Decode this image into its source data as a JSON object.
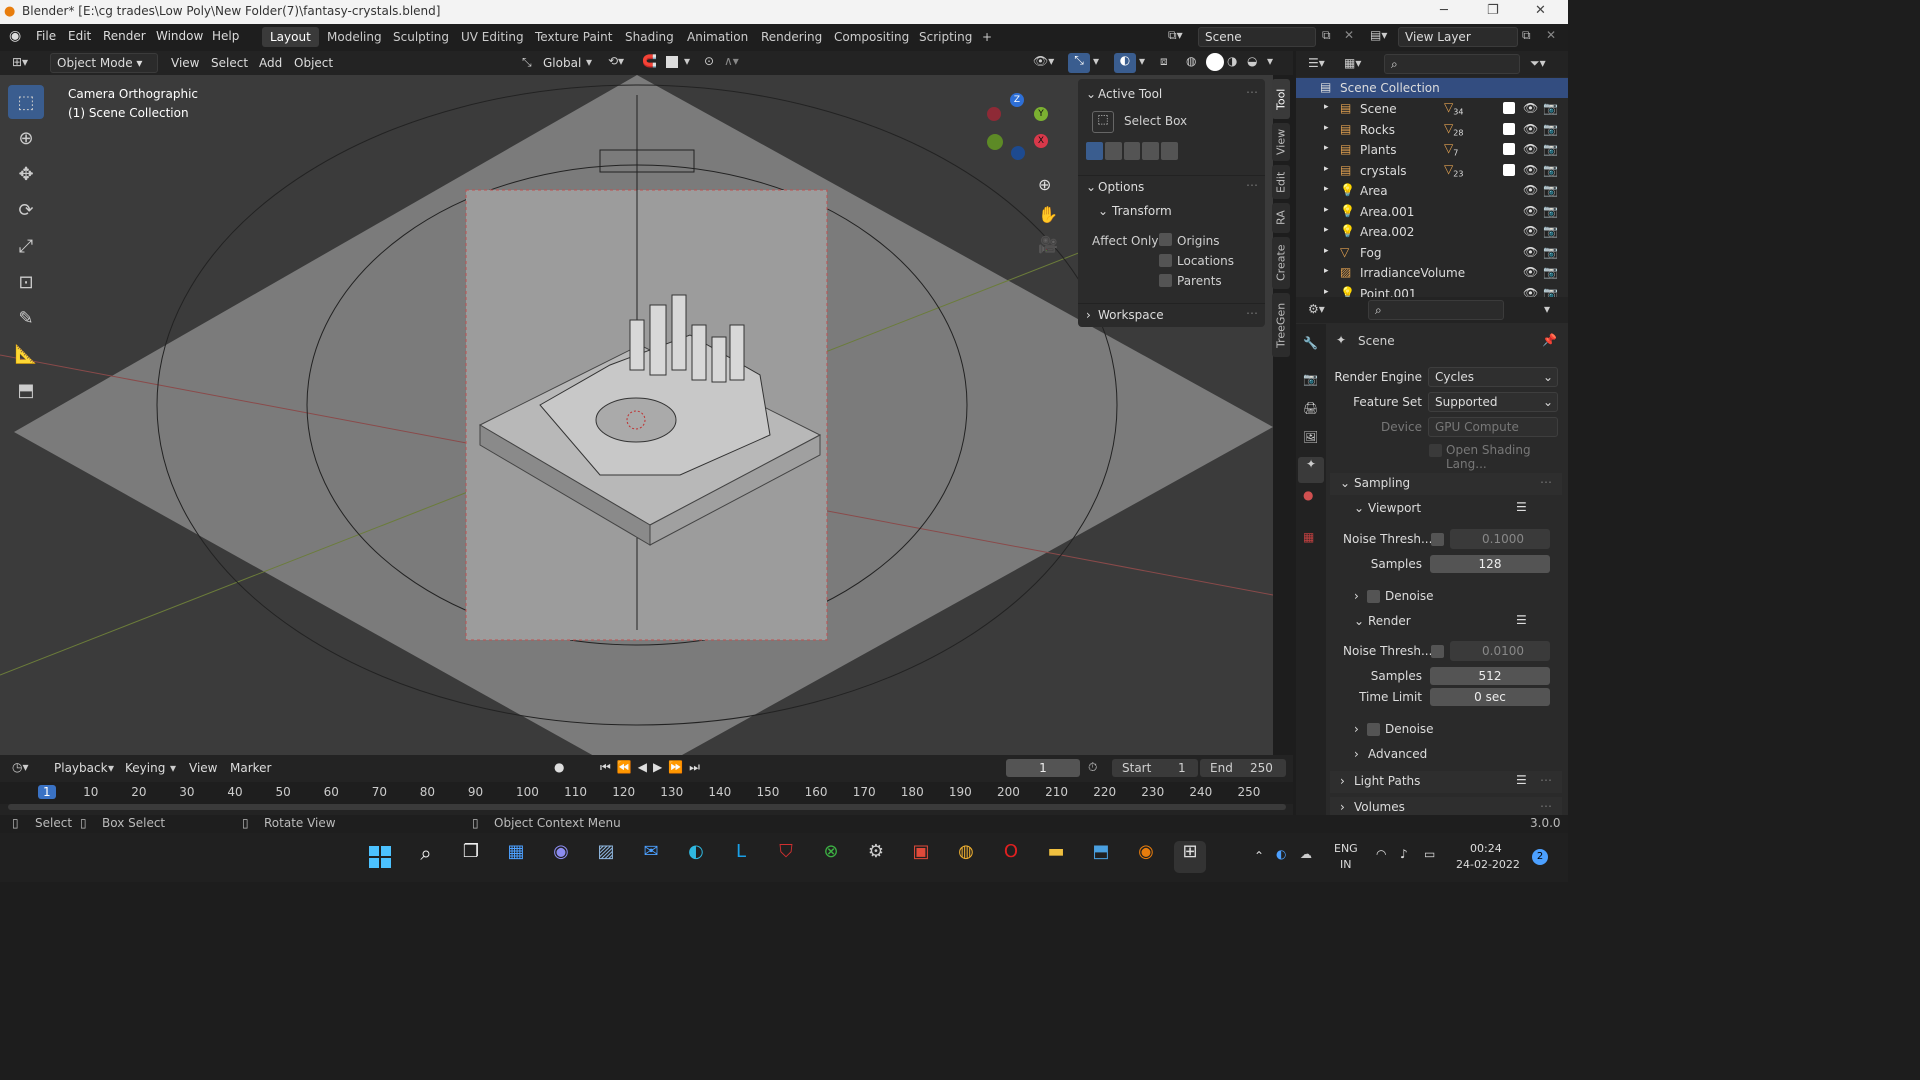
{
  "titlebar": {
    "title": "Blender* [E:\\cg trades\\Low Poly\\New Folder(7)\\fantasy-crystals.blend]",
    "minimize": "─",
    "maximize": "❐",
    "close": "✕"
  },
  "menus": [
    "File",
    "Edit",
    "Render",
    "Window",
    "Help"
  ],
  "workspaces": [
    "Layout",
    "Modeling",
    "Sculpting",
    "UV Editing",
    "Texture Paint",
    "Shading",
    "Animation",
    "Rendering",
    "Compositing",
    "Scripting"
  ],
  "workspace_add": "+",
  "scene_field": "Scene",
  "view_layer_field": "View Layer",
  "viewport_header": {
    "mode": "Object Mode",
    "menus": [
      "View",
      "Select",
      "Add",
      "Object"
    ],
    "orientation": "Global"
  },
  "viewport": {
    "camera_label": "Camera Orthographic",
    "collection_label": "(1) Scene Collection",
    "gizmo": {
      "x": "X",
      "y": "Y",
      "z": "Z"
    }
  },
  "active_tool": {
    "header": "Active Tool",
    "tool_name": "Select Box"
  },
  "options": {
    "header": "Options",
    "transform_header": "Transform",
    "affect_only": "Affect Only",
    "checks": [
      "Origins",
      "Locations",
      "Parents"
    ]
  },
  "workspace_section": "Workspace",
  "ntabs": [
    "Tool",
    "View",
    "Edit",
    "RA",
    "Create",
    "TreeGen"
  ],
  "outliner": {
    "root": "Scene Collection",
    "items": [
      {
        "name": "Scene",
        "badge": "34"
      },
      {
        "name": "Rocks",
        "badge": "28"
      },
      {
        "name": "Plants",
        "badge": "7"
      },
      {
        "name": "crystals",
        "badge": "23"
      },
      {
        "name": "Area",
        "badge": ""
      },
      {
        "name": "Area.001",
        "badge": ""
      },
      {
        "name": "Area.002",
        "badge": ""
      },
      {
        "name": "Fog",
        "badge": ""
      },
      {
        "name": "IrradianceVolume",
        "badge": ""
      },
      {
        "name": "Point.001",
        "badge": ""
      }
    ]
  },
  "properties": {
    "context": "Scene",
    "render_engine_label": "Render Engine",
    "render_engine": "Cycles",
    "feature_set_label": "Feature Set",
    "feature_set": "Supported",
    "device_label": "Device",
    "device": "GPU Compute",
    "osl_label": "Open Shading Lang...",
    "sampling": "Sampling",
    "viewport": "Viewport",
    "noise_label": "Noise Thresh...",
    "vp_noise": "0.1000",
    "samples_label": "Samples",
    "vp_samples": "128",
    "denoise": "Denoise",
    "render": "Render",
    "r_noise": "0.0100",
    "r_samples": "512",
    "time_limit_label": "Time Limit",
    "time_limit": "0 sec",
    "advanced": "Advanced",
    "light_paths": "Light Paths",
    "volumes": "Volumes"
  },
  "timeline": {
    "menus": [
      "Playback",
      "Keying",
      "View",
      "Marker"
    ],
    "current_frame": "1",
    "start_label": "Start",
    "start": "1",
    "end_label": "End",
    "end": "250",
    "ticks": [
      "1",
      "10",
      "20",
      "30",
      "40",
      "50",
      "60",
      "70",
      "80",
      "90",
      "100",
      "110",
      "120",
      "130",
      "140",
      "150",
      "160",
      "170",
      "180",
      "190",
      "200",
      "210",
      "220",
      "230",
      "240",
      "250"
    ]
  },
  "statusbar": {
    "select": "Select",
    "box_select": "Box Select",
    "rotate": "Rotate View",
    "context_menu": "Object Context Menu",
    "version": "3.0.0"
  },
  "taskbar": {
    "lang1": "ENG",
    "lang2": "IN",
    "time": "00:24",
    "date": "24-02-2022",
    "notif": "2"
  }
}
